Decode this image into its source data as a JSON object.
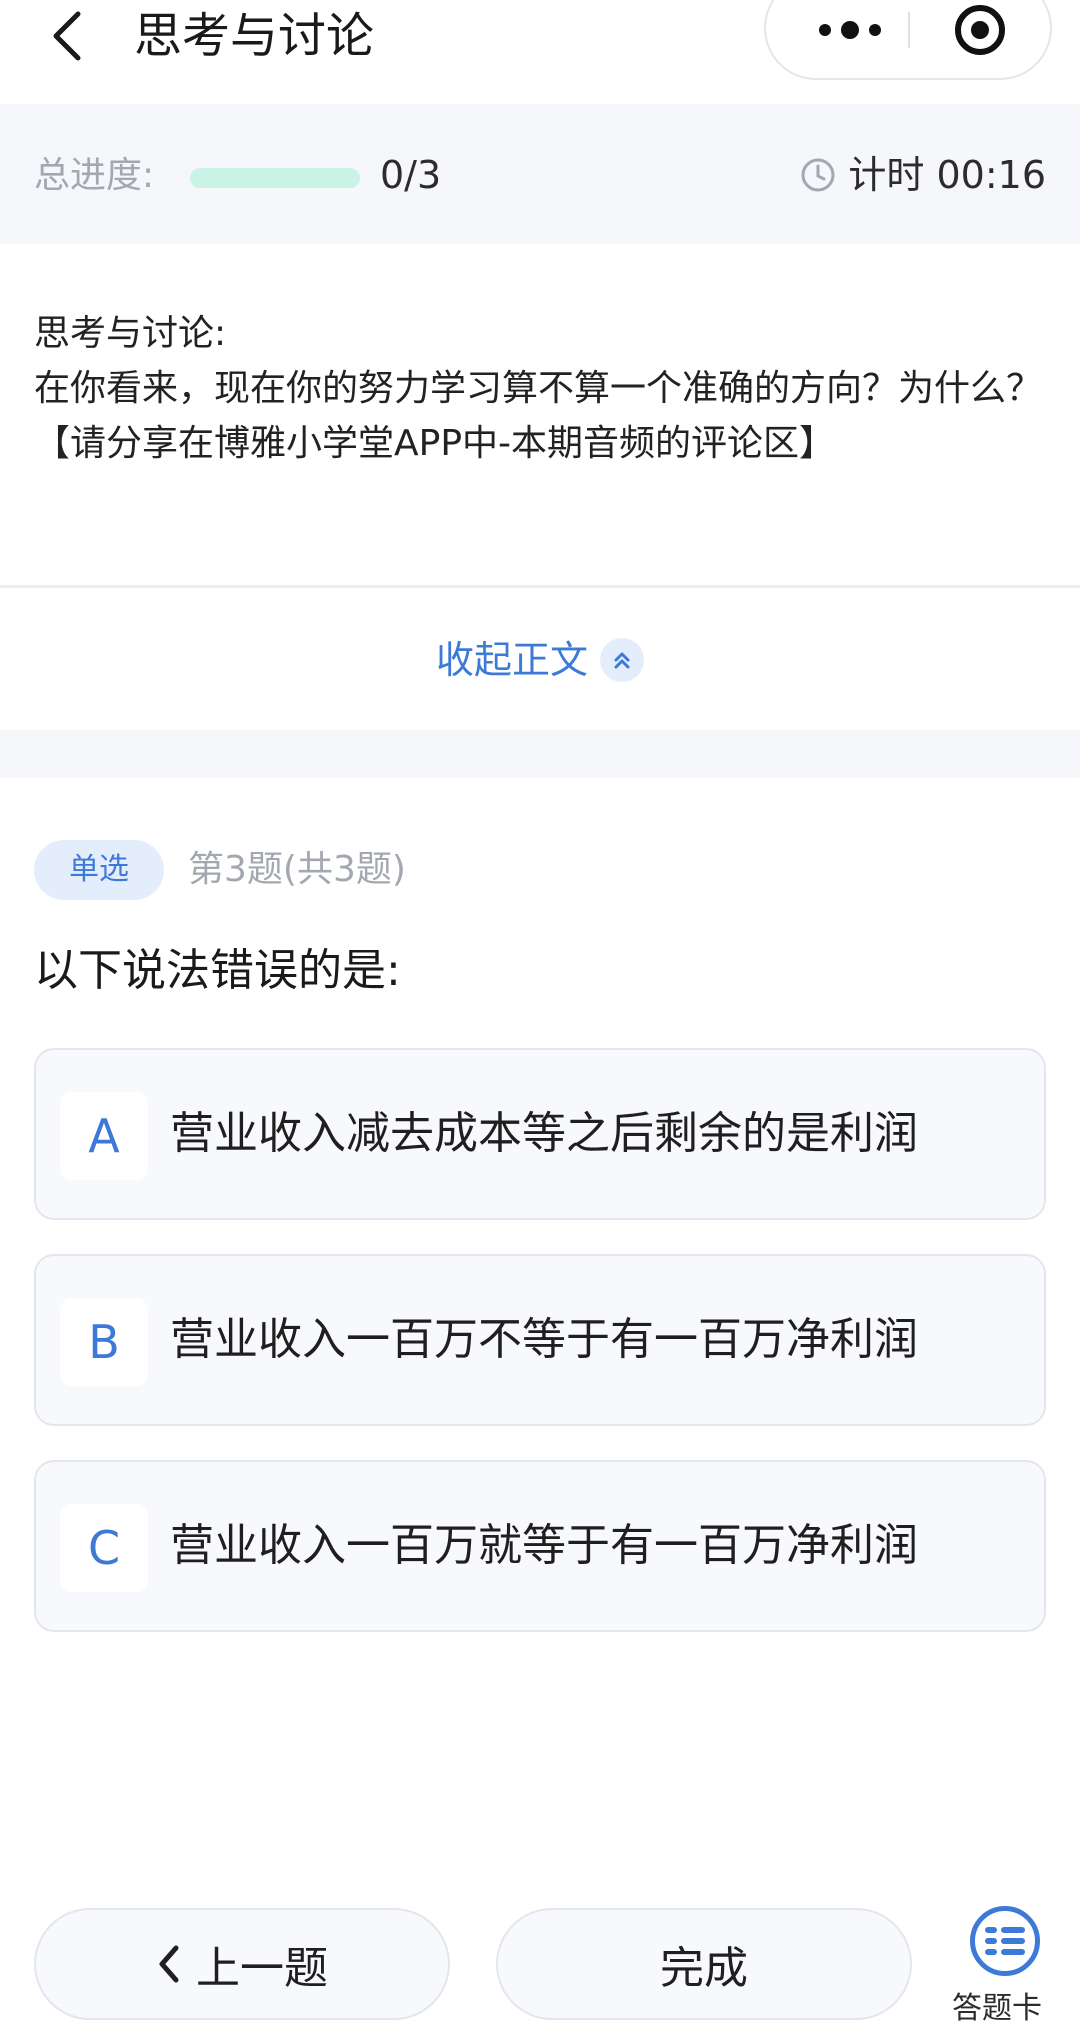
{
  "header": {
    "title": "思考与讨论"
  },
  "progress": {
    "label": "总进度:",
    "count": "0/3",
    "fraction": 0,
    "timer": "计时 00:16"
  },
  "passage": {
    "line1": "思考与讨论:",
    "line2": "在你看来，现在你的努力学习算不算一个准确的方向？为什么？",
    "line3": "【请分享在博雅小学堂APP中-本期音频的评论区】",
    "collapse_label": "收起正文"
  },
  "question": {
    "type_tag": "单选",
    "number": "第3题(共3题)",
    "text": "以下说法错误的是:",
    "options": [
      {
        "letter": "A",
        "text": "营业收入减去成本等之后剩余的是利润"
      },
      {
        "letter": "B",
        "text": "营业收入一百万不等于有一百万净利润"
      },
      {
        "letter": "C",
        "text": "营业收入一百万就等于有一百万净利润"
      }
    ]
  },
  "footer": {
    "prev_label": "上一题",
    "done_label": "完成",
    "card_label": "答题卡"
  },
  "colors": {
    "accent": "#3d7ad8",
    "progress_track": "#c8f3e5",
    "panel_bg": "#f5f7fb"
  },
  "icons": {
    "back": "chevron-left-icon",
    "more": "more-dots-icon",
    "target": "target-icon",
    "clock": "clock-icon",
    "collapse": "double-chevron-up-icon",
    "prev": "chevron-left-icon",
    "answer_card": "list-grid-icon"
  }
}
